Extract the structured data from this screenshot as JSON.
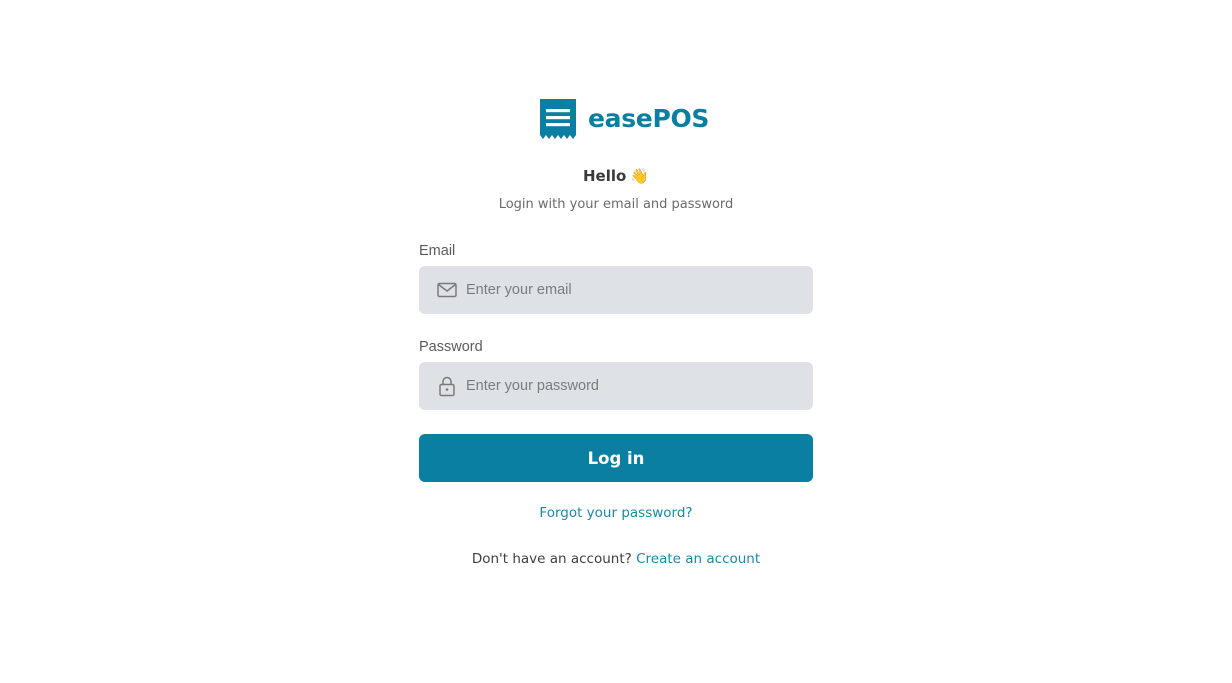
{
  "brand": {
    "name": "easePOS",
    "logo_icon": "receipt-icon",
    "accent_color": "#0a7fa1"
  },
  "greeting": {
    "title": "Hello",
    "emoji": "👋",
    "subtitle": "Login with your email and password"
  },
  "form": {
    "email": {
      "label": "Email",
      "placeholder": "Enter your email",
      "value": "",
      "icon": "mail-icon"
    },
    "password": {
      "label": "Password",
      "placeholder": "Enter your password",
      "value": "",
      "icon": "lock-icon"
    },
    "submit_label": "Log in"
  },
  "links": {
    "forgot_password": "Forgot your password?",
    "no_account_text": "Don't have an account?",
    "create_account": "Create an account"
  }
}
